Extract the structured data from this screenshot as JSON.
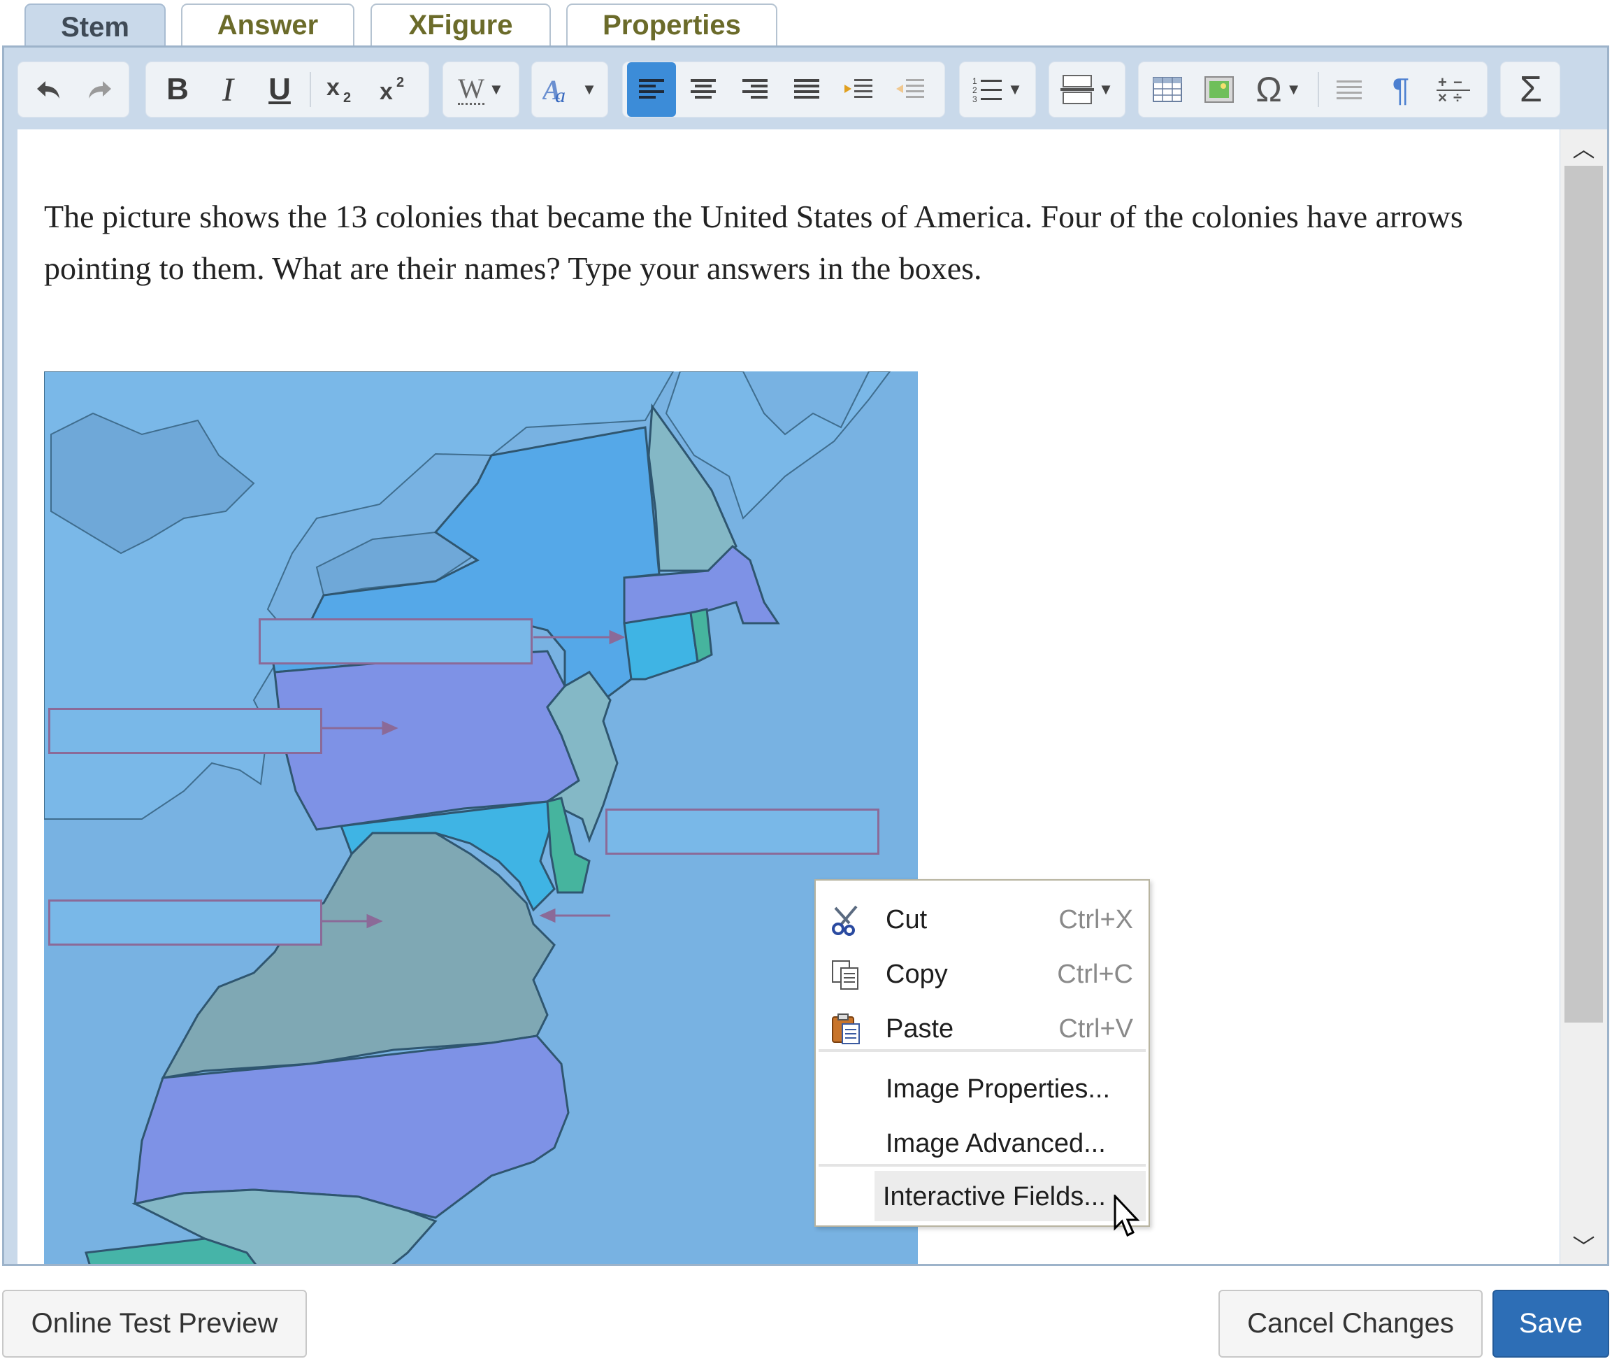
{
  "tabs": [
    {
      "label": "Stem",
      "active": true
    },
    {
      "label": "Answer"
    },
    {
      "label": "XFigure"
    },
    {
      "label": "Properties"
    }
  ],
  "toolbar": {
    "groups": [
      [
        "undo-icon",
        "redo-icon"
      ],
      [
        "bold-icon",
        "italic-icon",
        "underline-icon",
        "subscript-icon",
        "superscript-icon"
      ],
      [
        "font-icon"
      ],
      [
        "text-style-icon"
      ],
      [
        "align-left-icon",
        "align-center-icon",
        "align-right-icon",
        "align-justify-icon",
        "indent-icon",
        "outdent-icon"
      ],
      [
        "numbered-list-icon"
      ],
      [
        "page-break-icon"
      ],
      [
        "table-icon",
        "image-icon",
        "omega-icon",
        "paragraph-icon",
        "pilcrow-icon",
        "math-ops-icon"
      ],
      [
        "sigma-icon"
      ]
    ],
    "bold_label": "B",
    "italic_label": "I",
    "underline_label": "U",
    "font_label": "W",
    "omega_label": "Ω",
    "pilcrow_label": "¶",
    "sigma_label": "Σ",
    "active": "align-left-icon"
  },
  "content": {
    "stem_text": "The picture shows the 13 colonies that became the United States of America. Four of the colonies have arrows pointing to them. What are their names? Type your answers in the boxes.",
    "answer_fields": [
      {
        "id": 1,
        "value": ""
      },
      {
        "id": 2,
        "value": ""
      },
      {
        "id": 3,
        "value": ""
      },
      {
        "id": 4,
        "value": ""
      }
    ],
    "map_colors": {
      "water": "#78b2e2",
      "land": "#7ab6e6",
      "new_york": "#55a8e8",
      "new_hampshire": "#84b8c6",
      "massachusetts": "#7e92e6",
      "connecticut": "#3fb4e4",
      "rhode_island": "#46b49e",
      "pennsylvania": "#7e92e6",
      "new_jersey": "#84b8c6",
      "delaware": "#46b49e",
      "maryland": "#3fb4e4",
      "virginia": "#7fa8b4",
      "north_carolina": "#7e92e6",
      "south_carolina": "#84b8c6",
      "georgia": "#46b4a8"
    }
  },
  "context_menu": {
    "items": [
      {
        "label": "Cut",
        "shortcut": "Ctrl+X",
        "icon": "scissors-icon"
      },
      {
        "label": "Copy",
        "shortcut": "Ctrl+C",
        "icon": "copy-icon"
      },
      {
        "label": "Paste",
        "shortcut": "Ctrl+V",
        "icon": "paste-icon"
      },
      {
        "label": "Image Properties..."
      },
      {
        "label": "Image Advanced..."
      },
      {
        "label": "Interactive Fields...",
        "hovered": true
      }
    ]
  },
  "footer": {
    "preview_label": "Online Test Preview",
    "cancel_label": "Cancel Changes",
    "save_label": "Save"
  },
  "colors": {
    "accent": "#2d6eb6",
    "editor_chrome": "#c9d9ea",
    "tab_text": "#6b6b2a",
    "field_border": "#8b6a98"
  }
}
